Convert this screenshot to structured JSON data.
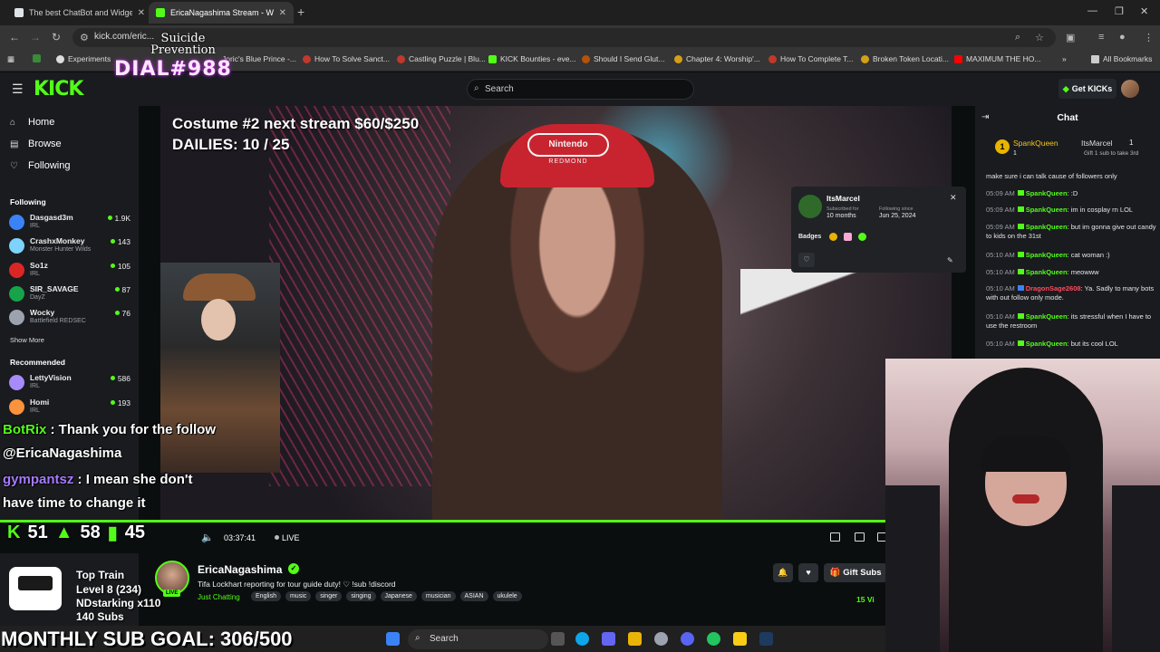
{
  "browser": {
    "tabs": [
      {
        "title": "The best ChatBot and Widgets",
        "active": false
      },
      {
        "title": "EricaNagashima Stream - W",
        "active": true
      }
    ],
    "url": "kick.com/eric...",
    "bookmarks": [
      "Experiments",
      "Dnnoe Area | Blue 8...",
      "Joric's Blue Prince -...",
      "How To Solve Sanct...",
      "Castling Puzzle | Blu...",
      "KICK Bounties - eve...",
      "Should I Send Glut...",
      "Chapter 4: Worship'...",
      "How To Complete T...",
      "Broken Token Locati...",
      "MAXIMUM THE HO...",
      "All Bookmarks"
    ]
  },
  "overlay_logo": {
    "line1": "Suicide",
    "line2": "Prevention",
    "dial": "DIAL#988"
  },
  "header": {
    "logo": "KICK",
    "search_placeholder": "Search",
    "get_kicks": "Get KICKs"
  },
  "sidebar": {
    "nav": [
      {
        "label": "Home",
        "icon": "home-icon"
      },
      {
        "label": "Browse",
        "icon": "browse-icon"
      },
      {
        "label": "Following",
        "icon": "heart-icon"
      }
    ],
    "following_title": "Following",
    "following": [
      {
        "name": "Dasgasd3m",
        "category": "IRL",
        "viewers": "1.9K",
        "color": "#3b82f6"
      },
      {
        "name": "CrashxMonkey",
        "category": "Monster Hunter Wilds",
        "viewers": "143",
        "color": "#7dd3fc"
      },
      {
        "name": "So1z",
        "category": "IRL",
        "viewers": "105",
        "color": "#dc2626"
      },
      {
        "name": "SIR_SAVAGE",
        "category": "DayZ",
        "viewers": "87",
        "color": "#16a34a"
      },
      {
        "name": "Wocky",
        "category": "Battlefield REDSEC",
        "viewers": "76",
        "color": "#9ca3af"
      }
    ],
    "show_more": "Show More",
    "recommended_title": "Recommended",
    "recommended": [
      {
        "name": "LettyVision",
        "category": "IRL",
        "viewers": "586",
        "color": "#a78bfa"
      },
      {
        "name": "Homi",
        "category": "IRL",
        "viewers": "193",
        "color": "#fb923c"
      }
    ]
  },
  "video": {
    "costume": "Costume #2 next stream $60/$250",
    "dailies": "DAILIES: 10 / 25",
    "cap_brand": "Nintendo",
    "cap_sub": "REDMOND",
    "elapsed": "03:37:41",
    "live": "LIVE",
    "progress": 1.0
  },
  "follow_popup": {
    "name": "ItsMarcel",
    "subscribed_label": "Subscribed for",
    "subscribed_value": "10 months",
    "following_label": "Following since",
    "following_value": "Jun 25, 2024",
    "badges_label": "Badges"
  },
  "stream_info": {
    "name": "EricaNagashima",
    "title": "Tifa Lockhart reporting for tour guide duty! ♡ !sub !discord",
    "category": "Just Chatting",
    "tags": [
      "English",
      "music",
      "singer",
      "singing",
      "Japanese",
      "musician",
      "ASIAN",
      "ukulele"
    ],
    "gift_subs": "Gift Subs",
    "viewers": "15 Vi",
    "live_badge": "LIVE"
  },
  "chat": {
    "title": "Chat",
    "pinned_a": "SpankQueen",
    "pinned_b": "ItsMarcel",
    "pinned_count": "1",
    "pinned_one": "1",
    "pinned_sub": "Gift 1 sub to take 3rd",
    "first_line": "make sure i can talk cause of followers only",
    "messages": [
      {
        "time": "05:09 AM",
        "user": "SpankQueen",
        "text": ":D"
      },
      {
        "time": "05:09 AM",
        "user": "SpankQueen",
        "text": "im in cosplay rn LOL"
      },
      {
        "time": "05:09 AM",
        "user": "SpankQueen",
        "text": "but im gonna give out candy to kids on the 31st"
      },
      {
        "time": "05:10 AM",
        "user": "SpankQueen",
        "text": "cat woman :)"
      },
      {
        "time": "05:10 AM",
        "user": "SpankQueen",
        "text": "meowww"
      },
      {
        "time": "05:10 AM",
        "user": "DragonSage2608",
        "text": "Ya. Sadly to many bots with out follow only mode."
      },
      {
        "time": "05:10 AM",
        "user": "SpankQueen",
        "text": "its stressful when I have to use the restroom"
      },
      {
        "time": "05:10 AM",
        "user": "SpankQueen",
        "text": "but its cool LOL"
      }
    ]
  },
  "alerts": {
    "line1_user": "BotRix",
    "line1_text": " : Thank you for the follow",
    "line2": "@EricaNagashima",
    "line3_user": "gympantsz",
    "line3_text": " : I mean she don't",
    "line4": "have time to change it"
  },
  "stats": {
    "kicks": "51",
    "up": "58",
    "bars": "45"
  },
  "train": {
    "title": "Top Train",
    "level": "Level 8 (234)",
    "top": "NDstarking x110",
    "subs": "140 Subs"
  },
  "monthly_goal": "MONTHLY SUB GOAL: 306/500",
  "taskbar": {
    "search": "Search"
  }
}
